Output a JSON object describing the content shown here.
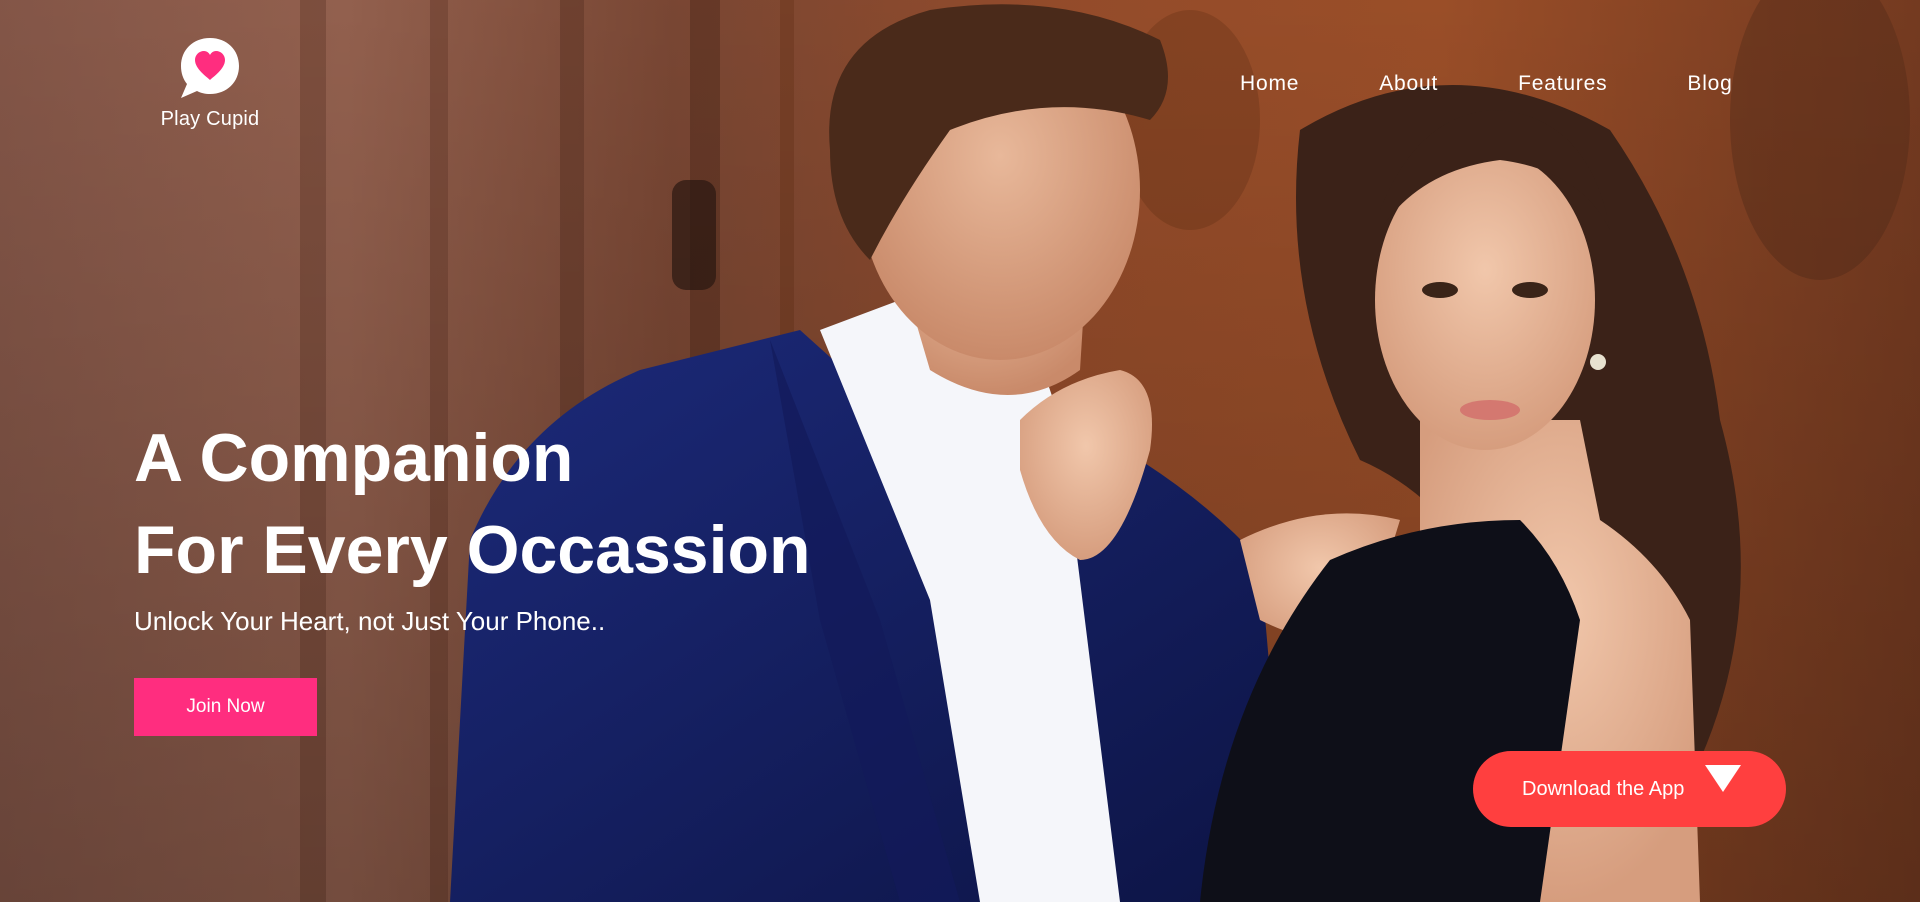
{
  "brand": {
    "name": "Play Cupid",
    "icon": "heart-chat-icon",
    "accent_color": "#ff2d7f"
  },
  "nav": {
    "items": [
      {
        "label": "Home"
      },
      {
        "label": "About"
      },
      {
        "label": "Features"
      },
      {
        "label": "Blog"
      }
    ]
  },
  "hero": {
    "headline_line1": "A Companion",
    "headline_line2": "For Every Occassion",
    "subtitle": "Unlock Your Heart, not Just Your Phone..",
    "join_label": "Join Now",
    "join_color": "#ff2d7f",
    "download_label": "Download the App",
    "download_color": "#ff3f3f",
    "download_icon": "download-triangle-icon"
  }
}
